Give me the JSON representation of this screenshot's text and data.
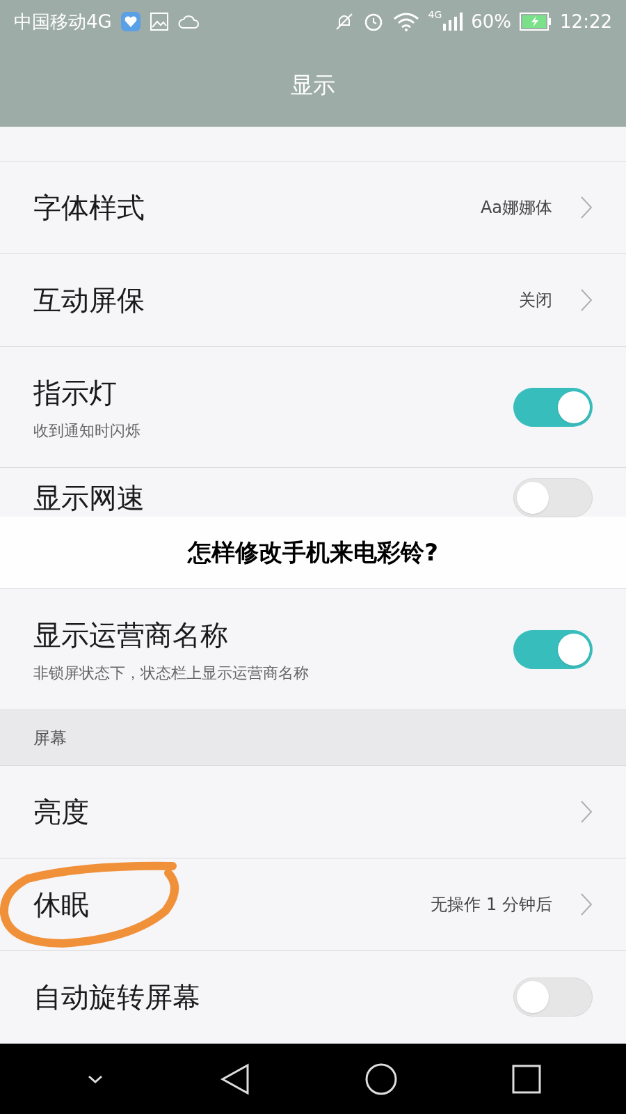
{
  "status_bar": {
    "carrier": "中国移动4G",
    "network": "4G",
    "battery": "60%",
    "time": "12:22"
  },
  "header": {
    "title": "显示"
  },
  "rows": [
    {
      "kind": "link",
      "title": "字体样式",
      "value": "Aa娜娜体",
      "circled": false
    },
    {
      "kind": "link",
      "title": "互动屏保",
      "value": "关闭",
      "circled": false
    },
    {
      "kind": "toggle",
      "title": "指示灯",
      "subtitle": "收到通知时闪烁",
      "on": true
    },
    {
      "kind": "toggle",
      "title": "显示网速",
      "on": false,
      "banner": "怎样修改手机来电彩铃?"
    },
    {
      "kind": "toggle",
      "title": "显示运营商名称",
      "subtitle": "非锁屏状态下，状态栏上显示运营商名称",
      "on": true
    },
    {
      "kind": "section",
      "title": "屏幕"
    },
    {
      "kind": "link",
      "title": "亮度",
      "circled": false
    },
    {
      "kind": "link",
      "title": "休眠",
      "value": "无操作 1 分钟后",
      "circled": true
    },
    {
      "kind": "toggle",
      "title": "自动旋转屏幕",
      "on": false
    }
  ]
}
